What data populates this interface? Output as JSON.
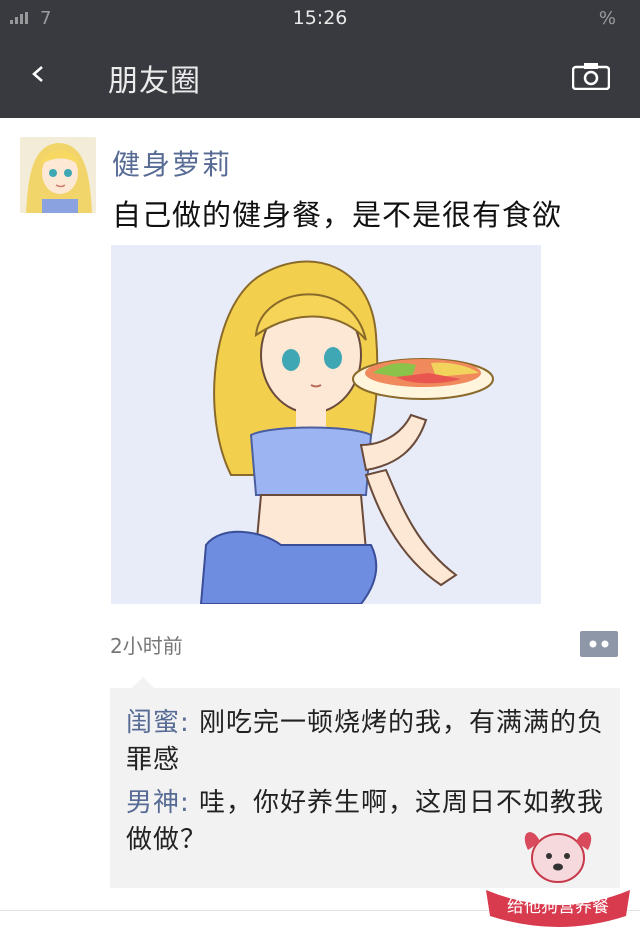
{
  "status_bar": {
    "left_text": "7",
    "time": "15:26",
    "battery_text": "%"
  },
  "nav": {
    "title": "朋友圈",
    "back_icon": "back-chevron-icon",
    "camera_icon": "camera-icon"
  },
  "post": {
    "username": "健身萝莉",
    "text": "自己做的健身餐，是不是很有食欲",
    "time_ago": "2小时前",
    "comments": [
      {
        "author": "闺蜜",
        "separator": ": ",
        "text": "刚吃完一顿烧烤的我，有满满的负罪感"
      },
      {
        "author": "男神",
        "separator": ": ",
        "text": "哇，你好养生啊，这周日不如教我做做？"
      }
    ]
  },
  "watermark": {
    "text": "给他狗营养餐"
  },
  "colors": {
    "nav_bg": "#393a3f",
    "username": "#576b95",
    "comment_bg": "#f2f2f2"
  }
}
